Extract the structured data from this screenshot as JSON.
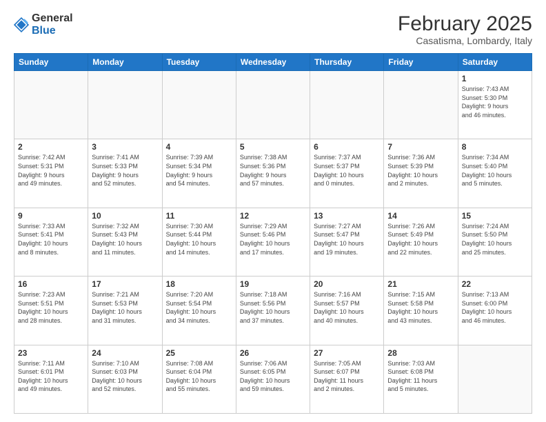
{
  "header": {
    "logo_general": "General",
    "logo_blue": "Blue",
    "month_year": "February 2025",
    "location": "Casatisma, Lombardy, Italy"
  },
  "weekdays": [
    "Sunday",
    "Monday",
    "Tuesday",
    "Wednesday",
    "Thursday",
    "Friday",
    "Saturday"
  ],
  "weeks": [
    [
      {
        "day": "",
        "info": ""
      },
      {
        "day": "",
        "info": ""
      },
      {
        "day": "",
        "info": ""
      },
      {
        "day": "",
        "info": ""
      },
      {
        "day": "",
        "info": ""
      },
      {
        "day": "",
        "info": ""
      },
      {
        "day": "1",
        "info": "Sunrise: 7:43 AM\nSunset: 5:30 PM\nDaylight: 9 hours\nand 46 minutes."
      }
    ],
    [
      {
        "day": "2",
        "info": "Sunrise: 7:42 AM\nSunset: 5:31 PM\nDaylight: 9 hours\nand 49 minutes."
      },
      {
        "day": "3",
        "info": "Sunrise: 7:41 AM\nSunset: 5:33 PM\nDaylight: 9 hours\nand 52 minutes."
      },
      {
        "day": "4",
        "info": "Sunrise: 7:39 AM\nSunset: 5:34 PM\nDaylight: 9 hours\nand 54 minutes."
      },
      {
        "day": "5",
        "info": "Sunrise: 7:38 AM\nSunset: 5:36 PM\nDaylight: 9 hours\nand 57 minutes."
      },
      {
        "day": "6",
        "info": "Sunrise: 7:37 AM\nSunset: 5:37 PM\nDaylight: 10 hours\nand 0 minutes."
      },
      {
        "day": "7",
        "info": "Sunrise: 7:36 AM\nSunset: 5:39 PM\nDaylight: 10 hours\nand 2 minutes."
      },
      {
        "day": "8",
        "info": "Sunrise: 7:34 AM\nSunset: 5:40 PM\nDaylight: 10 hours\nand 5 minutes."
      }
    ],
    [
      {
        "day": "9",
        "info": "Sunrise: 7:33 AM\nSunset: 5:41 PM\nDaylight: 10 hours\nand 8 minutes."
      },
      {
        "day": "10",
        "info": "Sunrise: 7:32 AM\nSunset: 5:43 PM\nDaylight: 10 hours\nand 11 minutes."
      },
      {
        "day": "11",
        "info": "Sunrise: 7:30 AM\nSunset: 5:44 PM\nDaylight: 10 hours\nand 14 minutes."
      },
      {
        "day": "12",
        "info": "Sunrise: 7:29 AM\nSunset: 5:46 PM\nDaylight: 10 hours\nand 17 minutes."
      },
      {
        "day": "13",
        "info": "Sunrise: 7:27 AM\nSunset: 5:47 PM\nDaylight: 10 hours\nand 19 minutes."
      },
      {
        "day": "14",
        "info": "Sunrise: 7:26 AM\nSunset: 5:49 PM\nDaylight: 10 hours\nand 22 minutes."
      },
      {
        "day": "15",
        "info": "Sunrise: 7:24 AM\nSunset: 5:50 PM\nDaylight: 10 hours\nand 25 minutes."
      }
    ],
    [
      {
        "day": "16",
        "info": "Sunrise: 7:23 AM\nSunset: 5:51 PM\nDaylight: 10 hours\nand 28 minutes."
      },
      {
        "day": "17",
        "info": "Sunrise: 7:21 AM\nSunset: 5:53 PM\nDaylight: 10 hours\nand 31 minutes."
      },
      {
        "day": "18",
        "info": "Sunrise: 7:20 AM\nSunset: 5:54 PM\nDaylight: 10 hours\nand 34 minutes."
      },
      {
        "day": "19",
        "info": "Sunrise: 7:18 AM\nSunset: 5:56 PM\nDaylight: 10 hours\nand 37 minutes."
      },
      {
        "day": "20",
        "info": "Sunrise: 7:16 AM\nSunset: 5:57 PM\nDaylight: 10 hours\nand 40 minutes."
      },
      {
        "day": "21",
        "info": "Sunrise: 7:15 AM\nSunset: 5:58 PM\nDaylight: 10 hours\nand 43 minutes."
      },
      {
        "day": "22",
        "info": "Sunrise: 7:13 AM\nSunset: 6:00 PM\nDaylight: 10 hours\nand 46 minutes."
      }
    ],
    [
      {
        "day": "23",
        "info": "Sunrise: 7:11 AM\nSunset: 6:01 PM\nDaylight: 10 hours\nand 49 minutes."
      },
      {
        "day": "24",
        "info": "Sunrise: 7:10 AM\nSunset: 6:03 PM\nDaylight: 10 hours\nand 52 minutes."
      },
      {
        "day": "25",
        "info": "Sunrise: 7:08 AM\nSunset: 6:04 PM\nDaylight: 10 hours\nand 55 minutes."
      },
      {
        "day": "26",
        "info": "Sunrise: 7:06 AM\nSunset: 6:05 PM\nDaylight: 10 hours\nand 59 minutes."
      },
      {
        "day": "27",
        "info": "Sunrise: 7:05 AM\nSunset: 6:07 PM\nDaylight: 11 hours\nand 2 minutes."
      },
      {
        "day": "28",
        "info": "Sunrise: 7:03 AM\nSunset: 6:08 PM\nDaylight: 11 hours\nand 5 minutes."
      },
      {
        "day": "",
        "info": ""
      }
    ]
  ]
}
